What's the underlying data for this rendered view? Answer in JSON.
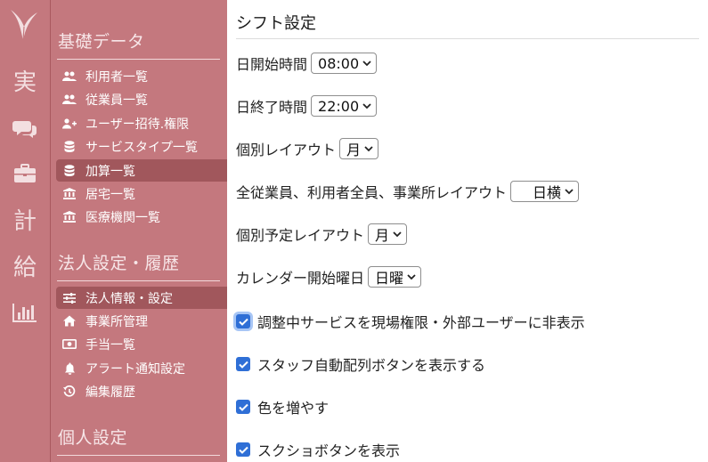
{
  "rail": {
    "items": [
      {
        "label": "実"
      },
      {
        "label": "計"
      },
      {
        "label": "給"
      }
    ]
  },
  "sidebar": {
    "sections": [
      {
        "title": "基礎データ",
        "items": [
          {
            "label": "利用者一覧",
            "icon": "users-icon"
          },
          {
            "label": "従業員一覧",
            "icon": "users-icon"
          },
          {
            "label": "ユーザー招待.権限",
            "icon": "user-plus-icon"
          },
          {
            "label": "サービスタイプ一覧",
            "icon": "database-icon"
          },
          {
            "label": "加算一覧",
            "icon": "database-icon",
            "active": true
          },
          {
            "label": "居宅一覧",
            "icon": "building-icon"
          },
          {
            "label": "医療機関一覧",
            "icon": "building-icon"
          }
        ]
      },
      {
        "title": "法人設定・履歴",
        "items": [
          {
            "label": "法人情報・設定",
            "icon": "sliders-icon",
            "active": true
          },
          {
            "label": "事業所管理",
            "icon": "home-icon"
          },
          {
            "label": "手当一覧",
            "icon": "money-icon"
          },
          {
            "label": "アラート通知設定",
            "icon": "bell-icon"
          },
          {
            "label": "編集履歴",
            "icon": "history-icon"
          }
        ]
      },
      {
        "title": "個人設定",
        "items": []
      }
    ]
  },
  "main": {
    "title": "シフト設定",
    "settings": [
      {
        "label": "日開始時間",
        "value": "08:00"
      },
      {
        "label": "日終了時間",
        "value": "22:00"
      },
      {
        "label": "個別レイアウト",
        "value": "月"
      },
      {
        "label": "全従業員、利用者全員、事業所レイアウト",
        "value": "日横"
      },
      {
        "label": "個別予定レイアウト",
        "value": "月"
      },
      {
        "label": "カレンダー開始曜日",
        "value": "日曜"
      }
    ],
    "checkboxes": [
      {
        "label": "調整中サービスを現場権限・外部ユーザーに非表示",
        "checked": true
      },
      {
        "label": "スタッフ自動配列ボタンを表示する",
        "checked": true
      },
      {
        "label": "色を増やす",
        "checked": true
      },
      {
        "label": "スクショボタンを表示",
        "checked": true
      }
    ]
  },
  "colors": {
    "sidebar_bg": "#c4787e",
    "active_item_bg": "#a1575c",
    "checkbox_blue": "#2f6fd6"
  }
}
